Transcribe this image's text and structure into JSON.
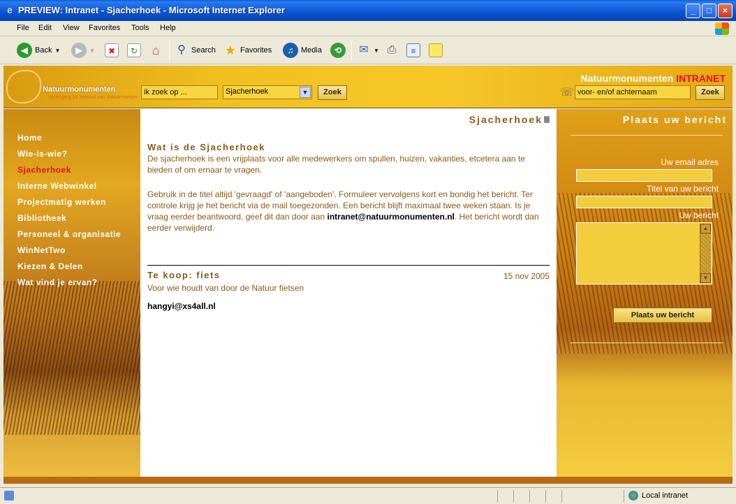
{
  "window": {
    "title": "PREVIEW: Intranet - Sjacherhoek - Microsoft Internet Explorer",
    "buttons": {
      "minimize": "_",
      "maximize": "□",
      "close": "×"
    }
  },
  "menubar": [
    "File",
    "Edit",
    "View",
    "Favorites",
    "Tools",
    "Help"
  ],
  "toolbar": {
    "back": "Back",
    "search": "Search",
    "favorites": "Favorites",
    "media": "Media"
  },
  "header": {
    "logo_brand": "Natuurmonumenten",
    "logo_sub": "Vereniging tot behoud van Natuurmonumenten in Nederland",
    "search_placeholder": "ik zoek op ...",
    "search_scope": "Sjacherhoek",
    "search_button": "Zoek",
    "people_placeholder": "voor- en/of achternaam",
    "people_button": "Zoek",
    "brand_title": "Natuurmonumenten",
    "brand_title_suffix": "INTRANET"
  },
  "nav": {
    "items": [
      "Home",
      "Wie-is-wie?",
      "Sjacherhoek",
      "Interne Webwinkel",
      "Projectmatig werken",
      "Bibliotheek",
      "Personeel & organisatie",
      "WinNetTwo",
      "Kiezen & Delen",
      "Wat vind je ervan?"
    ],
    "active": "Sjacherhoek"
  },
  "content": {
    "breadcrumb": "Sjacherhoek",
    "heading": "Wat is de Sjacherhoek",
    "intro": "De sjacherhoek is een vrijplaats voor alle medewerkers om spullen, huizen, vakanties, etcetera aan te bieden of om ernaar te vragen.",
    "instructions_part1": "Gebruik in de titel altijd 'gevraagd' of 'aangeboden'. Formuleer vervolgens kort en bondig het bericht. Ter controle krijg je het bericht via de mail toegezonden. Een bericht blijft maximaal twee weken staan. Is je vraag eerder beantwoord, geef dit dan door aan ",
    "instructions_email": "intranet@natuurmonumenten.nl",
    "instructions_part2": ". Het bericht wordt dan eerder verwijderd.",
    "post": {
      "title": "Te koop: fiets",
      "date": "15 nov 2005",
      "subtitle": "Voor wie houdt van door de Natuur fietsen",
      "email": "hangyi@xs4all.nl"
    }
  },
  "rightpanel": {
    "title": "Plaats uw bericht",
    "email_label": "Uw email adres",
    "title_label": "Titel van uw bericht",
    "message_label": "Uw bericht",
    "submit": "Plaats uw bericht"
  },
  "statusbar": {
    "zone": "Local intranet"
  }
}
